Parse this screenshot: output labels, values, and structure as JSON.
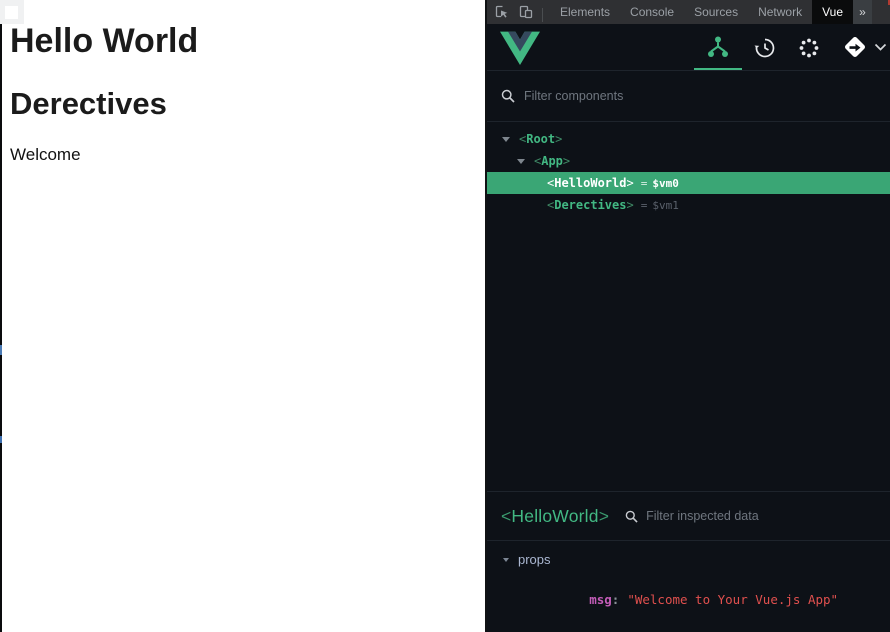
{
  "page": {
    "heading1": "Hello World",
    "heading2": "Derectives",
    "welcome": "Welcome"
  },
  "symbols": {
    "lt": "<",
    "gt": ">",
    "eq": "=",
    "colon": ":",
    "more_tabs": "»"
  },
  "devtools": {
    "tabs": [
      "Elements",
      "Console",
      "Sources",
      "Network",
      "Vue"
    ],
    "active_tab": "Vue",
    "toolbar_icons": [
      "inspect-element",
      "device-toolbar"
    ],
    "header_icons": [
      "components-tree",
      "timeline-history",
      "plugins-dots",
      "app-switch-diamond",
      "chevron-down"
    ],
    "search_placeholder": "Filter components",
    "tree": {
      "rows": [
        {
          "name": "Root",
          "vm": ""
        },
        {
          "name": "App",
          "vm": ""
        },
        {
          "name": "HelloWorld",
          "vm": "$vm0"
        },
        {
          "name": "Derectives",
          "vm": "$vm1"
        }
      ]
    },
    "inspector": {
      "component_name": "HelloWorld",
      "search_placeholder": "Filter inspected data",
      "props_label": "props",
      "prop_key": "msg",
      "prop_value": "\"Welcome to Your Vue.js App\""
    },
    "colors": {
      "accent_green": "#42b883",
      "selected_row": "#3aa675",
      "prop_key": "#c45db9",
      "prop_value": "#e0504e",
      "panel_bg": "#0d1117"
    }
  }
}
